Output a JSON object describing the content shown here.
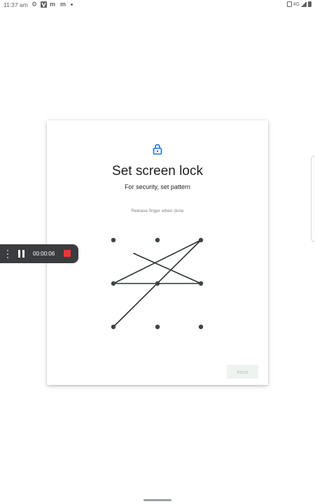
{
  "status_bar": {
    "time": "11:37 am",
    "icons": [
      "settings-icon",
      "v-app-icon",
      "gmail-icon",
      "gmail-icon",
      "dot-icon"
    ],
    "right_icons": [
      "vibrate-icon",
      "network-4g-icon",
      "signal-icon",
      "battery-icon"
    ],
    "network": "4G"
  },
  "card": {
    "title": "Set screen lock",
    "subtitle": "For security, set pattern",
    "hint": "Release finger when done",
    "next_label": "Next",
    "accent_color": "#1a73e8",
    "pattern_sequence": [
      6,
      4,
      2,
      3,
      5
    ]
  },
  "recorder": {
    "elapsed": "00:00:06",
    "stop_color": "#e53935"
  }
}
